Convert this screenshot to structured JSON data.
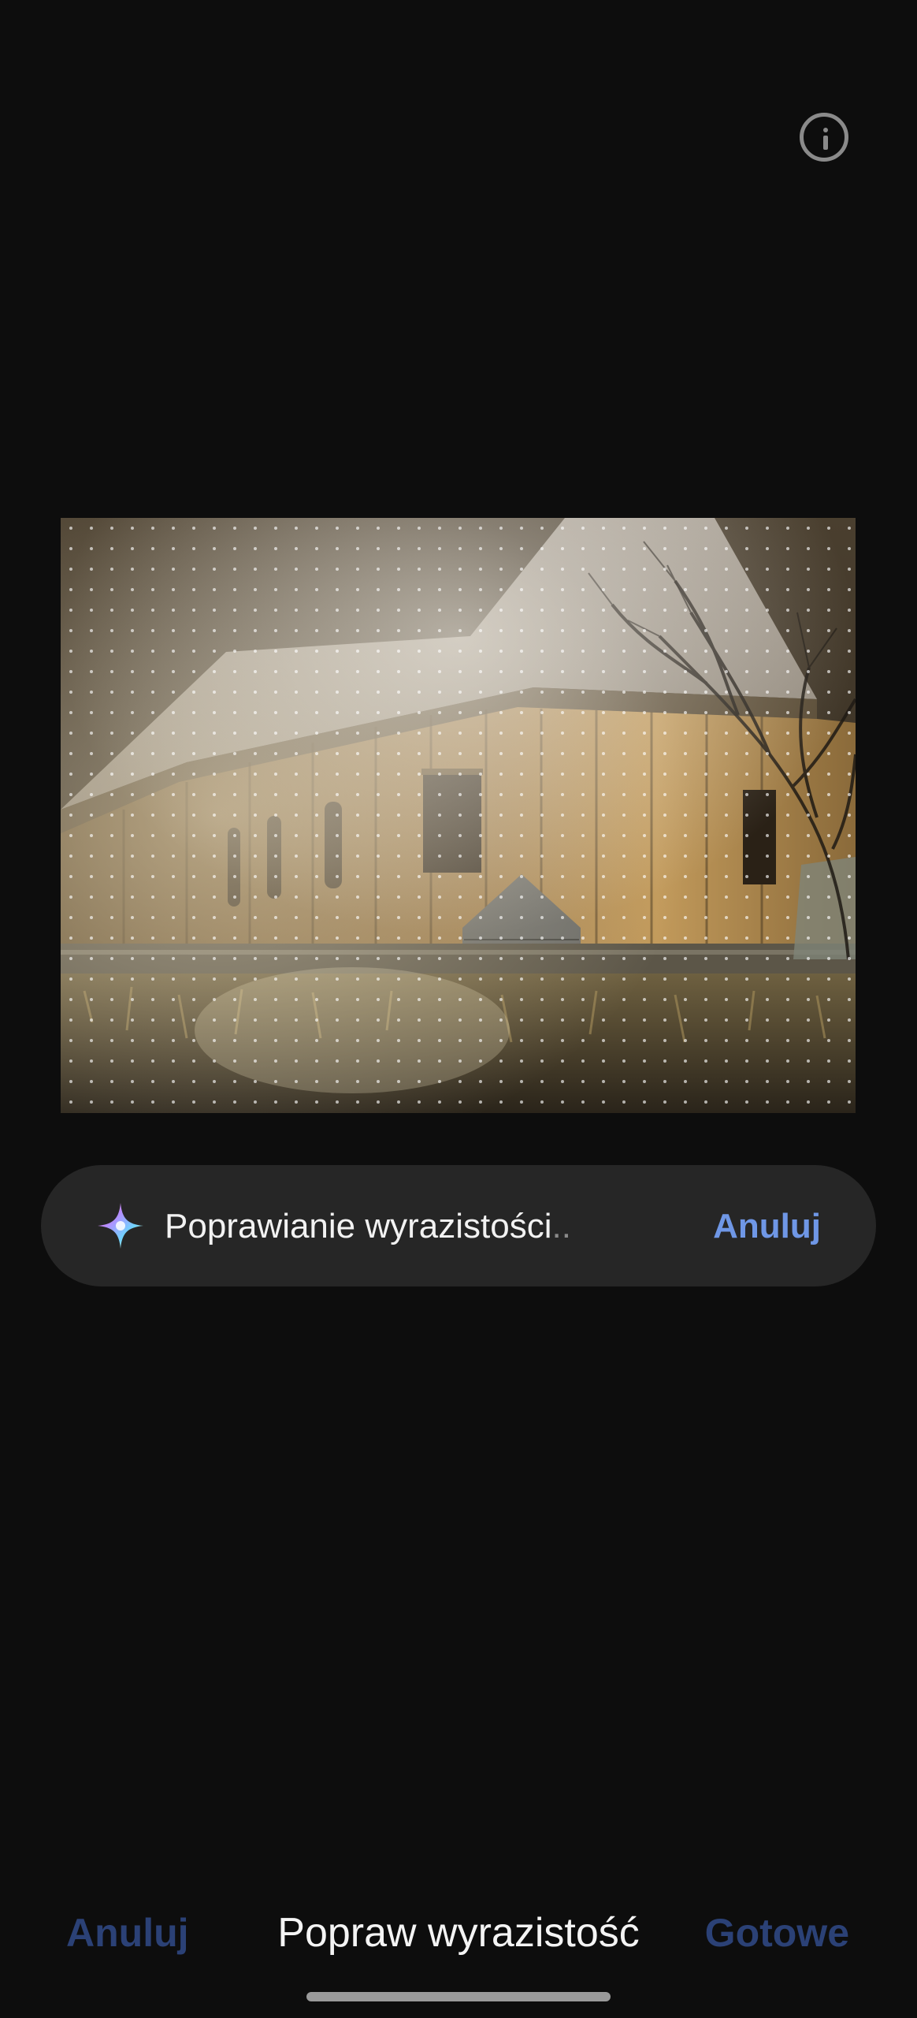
{
  "info_button": {
    "icon": "info-icon"
  },
  "photo": {
    "description_icon": "photo-preview"
  },
  "progress": {
    "icon": "sparkle-icon",
    "text": "Poprawianie wyrazistości",
    "ellipsis": "..",
    "cancel_label": "Anuluj",
    "accent_color": "#6f97e6"
  },
  "bottom_bar": {
    "cancel_label": "Anuluj",
    "title": "Popraw wyrazistość",
    "done_label": "Gotowe"
  }
}
